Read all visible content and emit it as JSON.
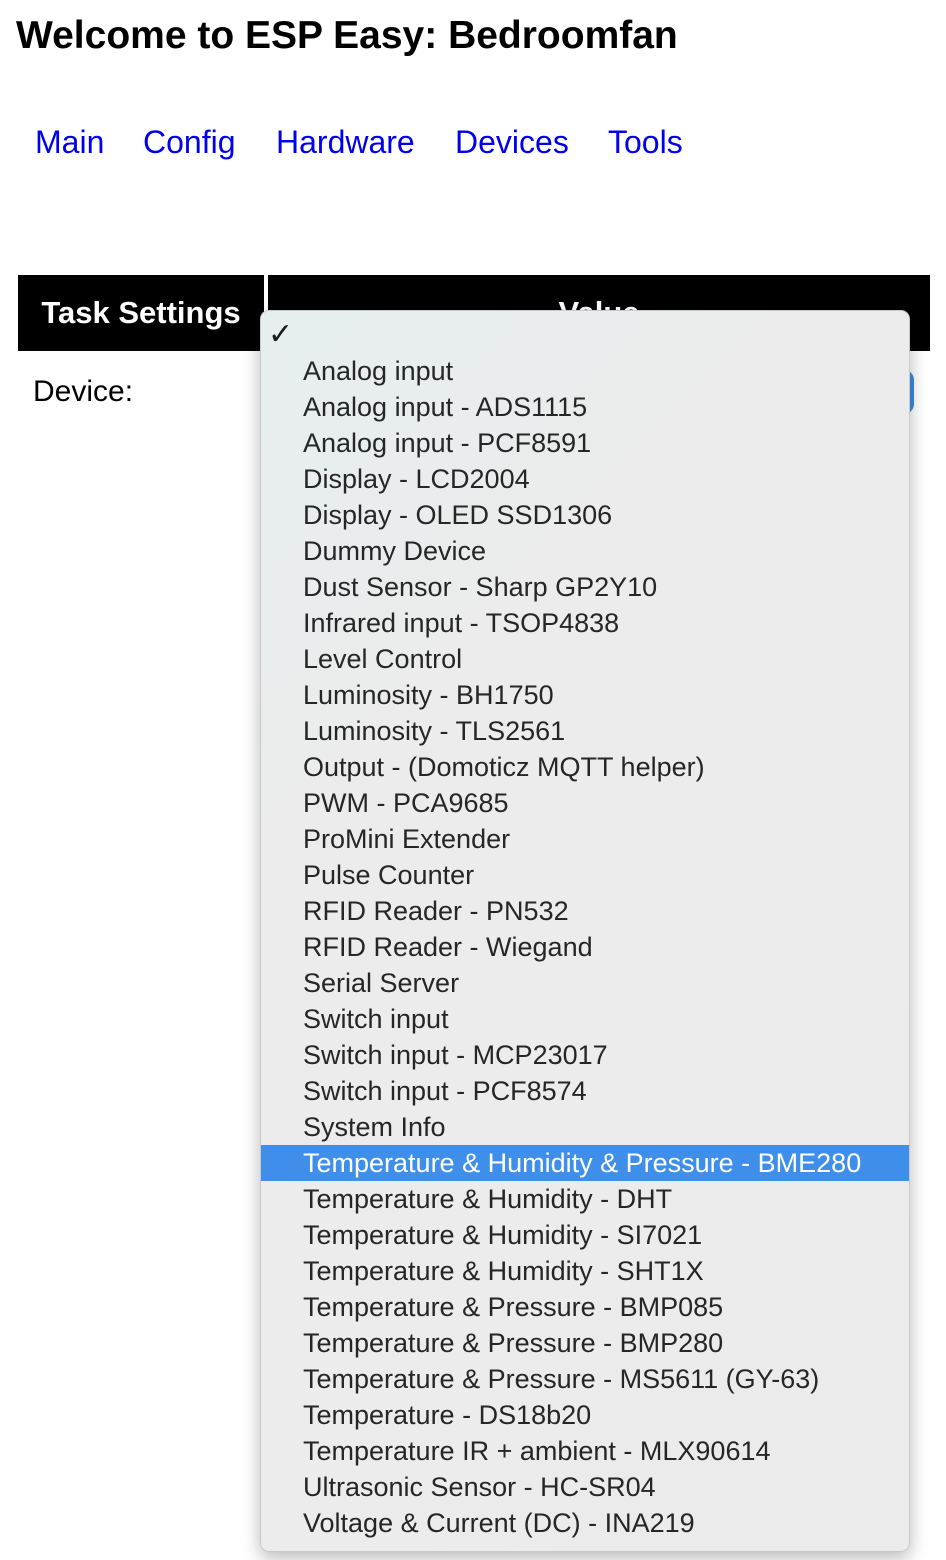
{
  "page": {
    "title": "Welcome to ESP Easy: Bedroomfan"
  },
  "nav": {
    "items": [
      {
        "label": "Main"
      },
      {
        "label": "Config"
      },
      {
        "label": "Hardware"
      },
      {
        "label": "Devices"
      },
      {
        "label": "Tools"
      }
    ]
  },
  "table": {
    "headers": [
      "Task Settings",
      "Value"
    ],
    "device_label": "Device:"
  },
  "device_select": {
    "checkmark": "✓",
    "highlighted_option": "Temperature & Humidity & Pressure - BME280",
    "highlight_color": "#3f8fea",
    "options": [
      "Analog input",
      "Analog input - ADS1115",
      "Analog input - PCF8591",
      "Display - LCD2004",
      "Display - OLED SSD1306",
      "Dummy Device",
      "Dust Sensor - Sharp GP2Y10",
      "Infrared input - TSOP4838",
      "Level Control",
      "Luminosity - BH1750",
      "Luminosity - TLS2561",
      "Output - (Domoticz MQTT helper)",
      "PWM - PCA9685",
      "ProMini Extender",
      "Pulse Counter",
      "RFID Reader - PN532",
      "RFID Reader - Wiegand",
      "Serial Server",
      "Switch input",
      "Switch input - MCP23017",
      "Switch input - PCF8574",
      "System Info",
      "Temperature & Humidity & Pressure - BME280",
      "Temperature & Humidity - DHT",
      "Temperature & Humidity - SI7021",
      "Temperature & Humidity - SHT1X",
      "Temperature & Pressure - BMP085",
      "Temperature & Pressure - BMP280",
      "Temperature & Pressure - MS5611 (GY-63)",
      "Temperature - DS18b20",
      "Temperature IR + ambient - MLX90614",
      "Ultrasonic Sensor - HC-SR04",
      "Voltage & Current (DC) - INA219"
    ]
  }
}
